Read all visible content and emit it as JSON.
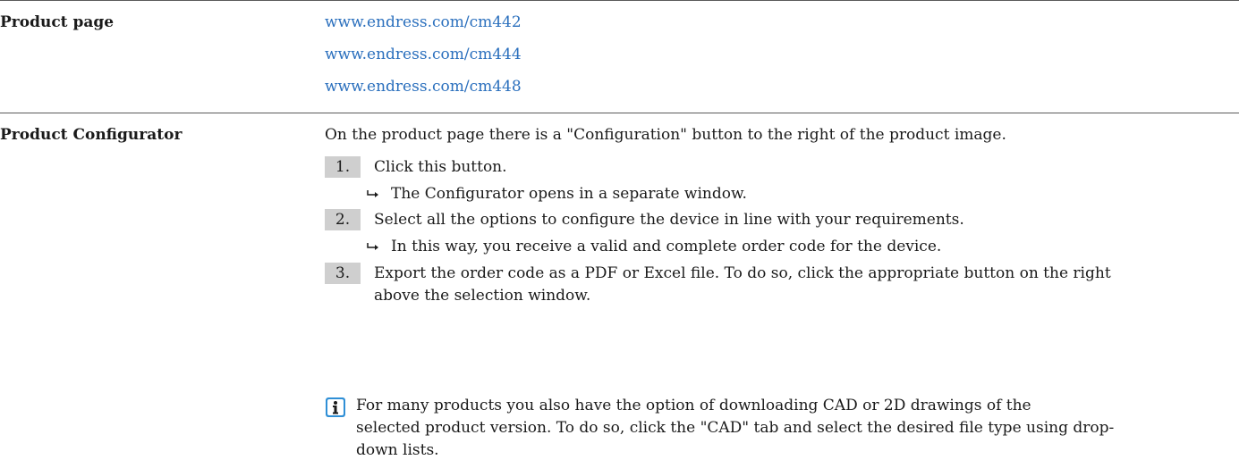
{
  "product_page": {
    "label": "Product page",
    "links": [
      "www.endress.com/cm442",
      "www.endress.com/cm444",
      "www.endress.com/cm448"
    ]
  },
  "product_configurator": {
    "label": "Product Configurator",
    "intro": "On the product page there is a \"Configuration\" button to the right of the product image.",
    "steps": [
      {
        "number": "1.",
        "text": "Click this button.",
        "result": "The Configurator opens in a separate window."
      },
      {
        "number": "2.",
        "text": "Select all the options to configure the device in line with your requirements.",
        "result": "In this way, you receive a valid and complete order code for the device."
      },
      {
        "number": "3.",
        "text_line1": "Export the order code as a PDF or Excel file. To do so, click the appropriate button on the right",
        "text_line2": "above the selection window."
      }
    ],
    "note": {
      "icon": "info-icon",
      "line1": "For many products you also have the option of downloading CAD or 2D drawings of the",
      "line2": "selected product version. To do so, click the \"CAD\" tab and select the desired file type using drop-",
      "line3": "down lists."
    }
  },
  "colors": {
    "link": "#2a6fbd",
    "step_badge": "#cfcfcf",
    "info_icon": "#2f8fd6"
  }
}
